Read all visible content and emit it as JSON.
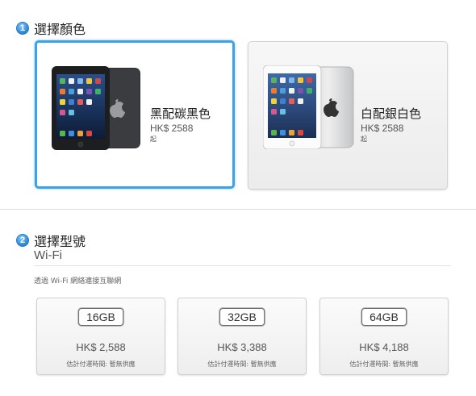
{
  "step1": {
    "number": "1",
    "title": "選擇顏色"
  },
  "colors": [
    {
      "name": "黑配碳黑色",
      "price": "HK$ 2588",
      "from": "起",
      "selected": true
    },
    {
      "name": "白配銀白色",
      "price": "HK$ 2588",
      "from": "起",
      "selected": false
    }
  ],
  "step2": {
    "number": "2",
    "title": "選擇型號"
  },
  "connectivity": {
    "title": "Wi-Fi",
    "description": "透過 Wi-Fi 網絡連接互聯網"
  },
  "models": [
    {
      "capacity": "16GB",
      "price": "HK$ 2,588",
      "shipping": "估計付運時間: 暫無供應"
    },
    {
      "capacity": "32GB",
      "price": "HK$ 3,388",
      "shipping": "估計付運時間: 暫無供應"
    },
    {
      "capacity": "64GB",
      "price": "HK$ 4,188",
      "shipping": "估計付運時間: 暫無供應"
    }
  ]
}
